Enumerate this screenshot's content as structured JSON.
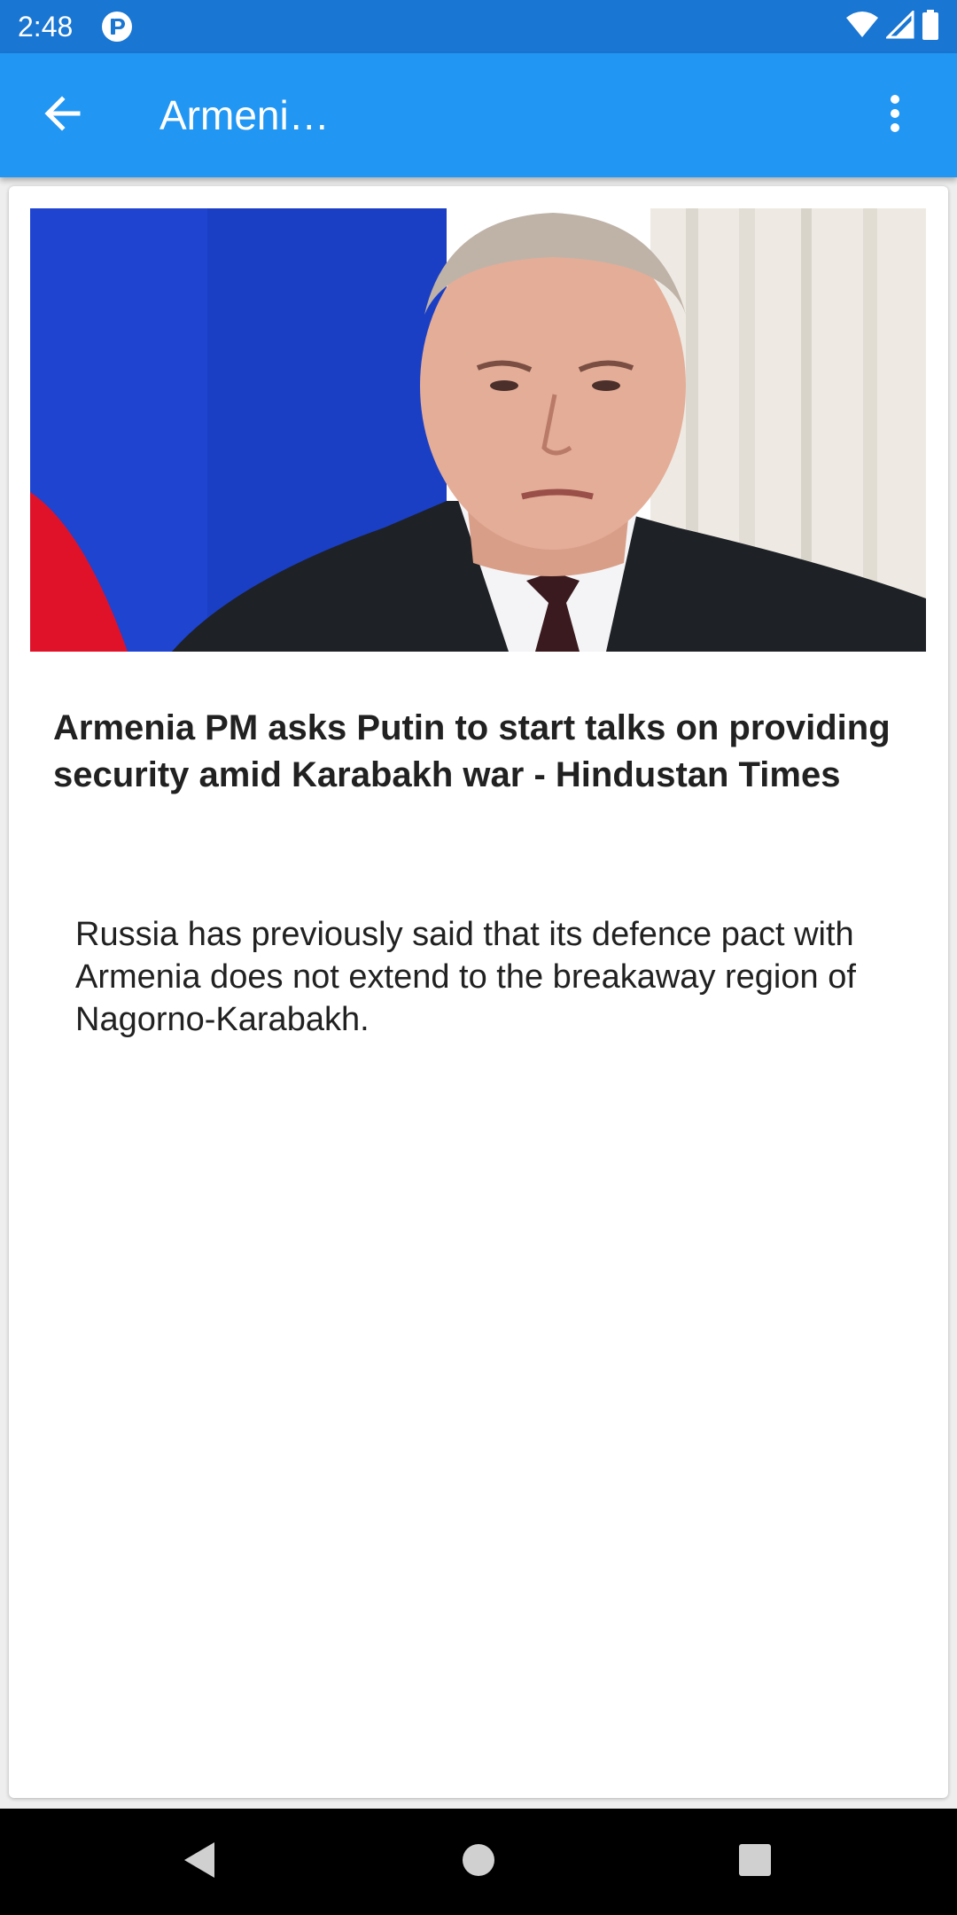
{
  "status_bar": {
    "time": "2:48",
    "icons": [
      "app-notification-icon",
      "wifi-icon",
      "cell-signal-icon",
      "battery-icon"
    ]
  },
  "app_bar": {
    "title": "Armeni…",
    "back_icon": "arrow-back-icon",
    "menu_icon": "more-vert-icon",
    "color": "#2196f3",
    "status_color": "#1976d2"
  },
  "article": {
    "image_description_icon": "article-photo",
    "headline": "Armenia PM asks Putin to start talks on providing security amid Karabakh war - Hindustan Times",
    "description": "Russia has previously said that its defence pact with Armenia does not extend to the breakaway region of Nagorno-Karabakh."
  },
  "nav_bar": {
    "icons": [
      "nav-back-icon",
      "nav-home-icon",
      "nav-recents-icon"
    ]
  }
}
